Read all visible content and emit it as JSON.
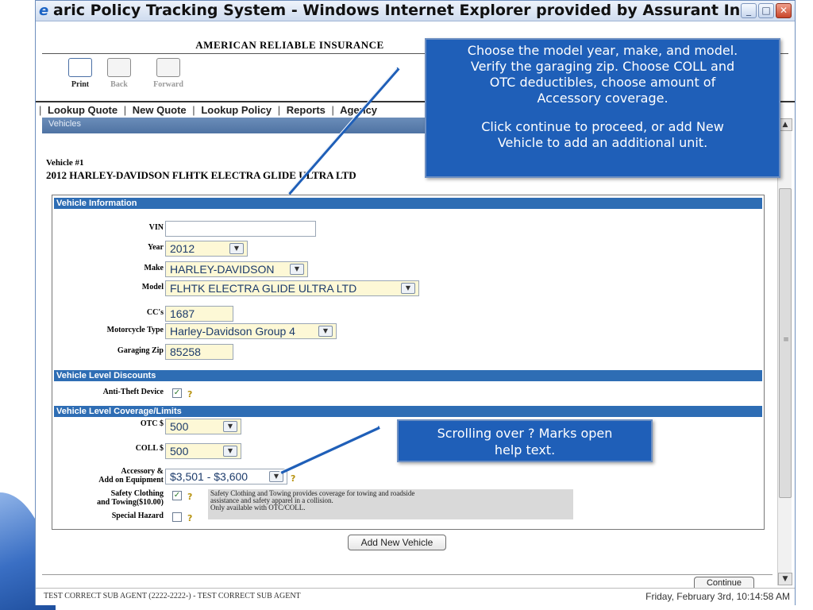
{
  "window": {
    "title": "aric Policy Tracking System - Windows Internet Explorer provided by Assurant Inc",
    "min_glyph": "_",
    "max_glyph": "□",
    "close_glyph": "✕"
  },
  "header": {
    "company": "AMERICAN RELIABLE INSURANCE"
  },
  "toolbar": {
    "print": "Print",
    "back": "Back",
    "forward": "Forward"
  },
  "nav": {
    "items": [
      "Lookup Quote",
      "New Quote",
      "Lookup Policy",
      "Reports",
      "Agency"
    ],
    "separator": "|"
  },
  "section": {
    "title": "Vehicles"
  },
  "vehicle": {
    "number": "Vehicle #1",
    "name": "2012 HARLEY-DAVIDSON FLHTK ELECTRA GLIDE ULTRA LTD"
  },
  "vehicle_info": {
    "header": "Vehicle Information",
    "vin_label": "VIN",
    "vin_value": "",
    "year_label": "Year",
    "year_value": "2012",
    "make_label": "Make",
    "make_value": "HARLEY-DAVIDSON",
    "model_label": "Model",
    "model_value": "FLHTK ELECTRA GLIDE ULTRA LTD",
    "cc_label": "CC's",
    "cc_value": "1687",
    "type_label": "Motorcycle Type",
    "type_value": "Harley-Davidson Group 4",
    "zip_label": "Garaging Zip",
    "zip_value": "85258"
  },
  "discounts": {
    "header": "Vehicle Level Discounts",
    "anti_theft_label": "Anti-Theft Device",
    "anti_theft_checked": true
  },
  "coverage": {
    "header": "Vehicle Level Coverage/Limits",
    "otc_label": "OTC $",
    "otc_value": "500",
    "coll_label": "COLL $",
    "coll_value": "500",
    "accessory_label_1": "Accessory &",
    "accessory_label_2": "Add on Equipment",
    "accessory_value": "$3,501 - $3,600",
    "safety_label_1": "Safety Clothing",
    "safety_label_2": "and Towing($10.00)",
    "safety_checked": true,
    "special_label": "Special Hazard",
    "special_checked": false,
    "help_line_1": "Safety Clothing and Towing provides coverage for towing and roadside",
    "help_line_2": "assistance and safety apparel in a collision.",
    "help_line_3": "Only available with OTC/COLL."
  },
  "icons": {
    "checkmark": "✓",
    "dropdown": "▼",
    "help_bulb": "?",
    "scroll_up": "▲",
    "scroll_down": "▼",
    "grip": "≡"
  },
  "actions": {
    "add_vehicle": "Add New Vehicle",
    "continue": "Continue"
  },
  "status": {
    "agent": "TEST CORRECT SUB AGENT (2222-2222-) - TEST CORRECT SUB AGENT",
    "datetime": "Friday, February 3rd, 10:14:58 AM"
  },
  "callouts": {
    "main_line_1": "Choose the model year, make, and model.",
    "main_line_2": "Verify the garaging zip. Choose COLL and",
    "main_line_3": "OTC deductibles, choose amount of",
    "main_line_4": "Accessory coverage.",
    "main_line_5": "Click continue to proceed, or add New",
    "main_line_6": "Vehicle to add an additional unit.",
    "help_line_1": "Scrolling over ? Marks open",
    "help_line_2": "help text."
  },
  "colors": {
    "callout": "#1f5fb8",
    "section_header": "#2e6db4",
    "field_fill": "#fdf8d6"
  }
}
